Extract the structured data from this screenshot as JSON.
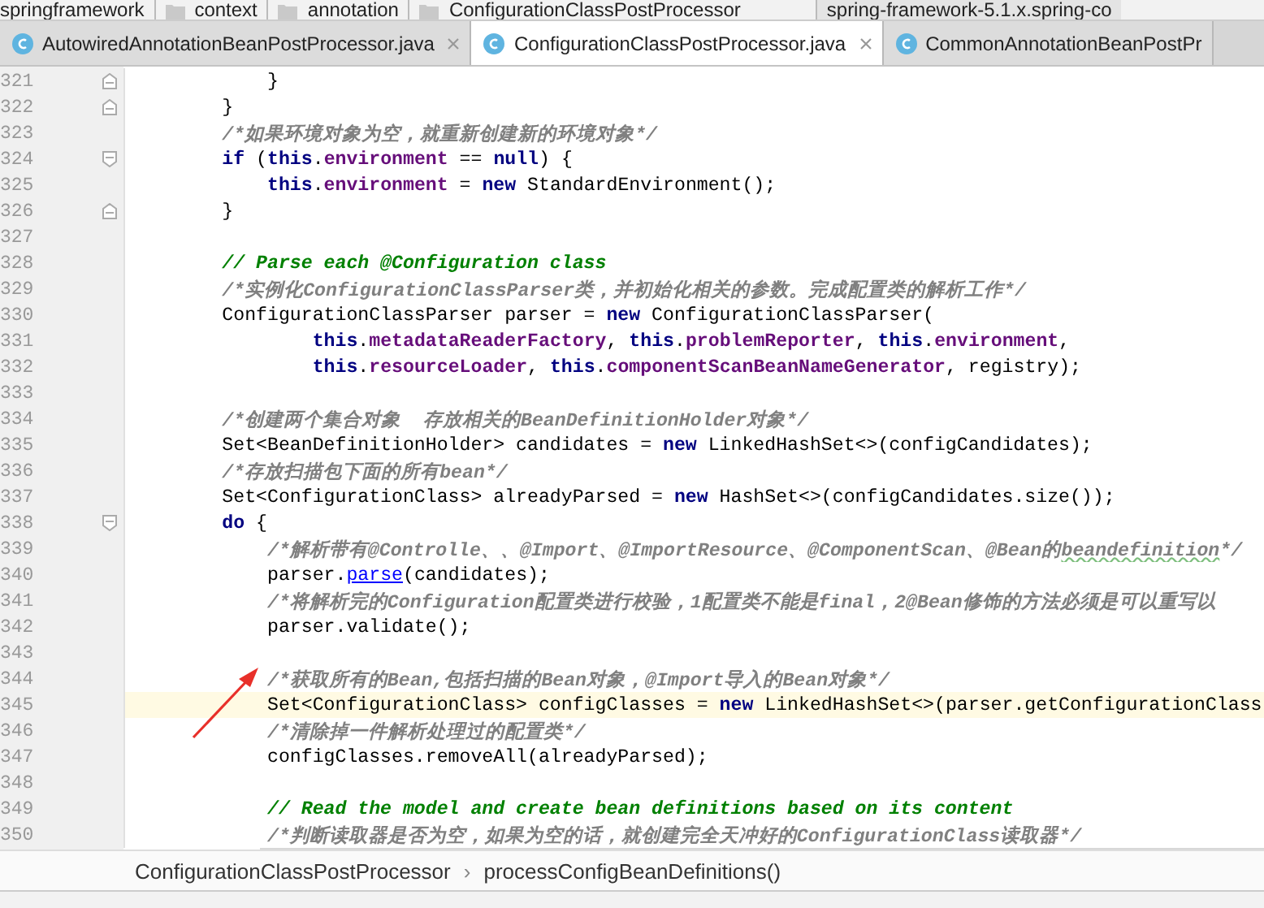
{
  "path_bar": {
    "items": [
      "springframework",
      "context",
      "annotation",
      "ConfigurationClassPostProcessor"
    ],
    "project": "spring-framework-5.1.x.spring-co"
  },
  "tabs": [
    {
      "label": "AutowiredAnnotationBeanPostProcessor.java",
      "selected": false,
      "closable": true
    },
    {
      "label": "ConfigurationClassPostProcessor.java",
      "selected": true,
      "closable": true
    },
    {
      "label": "CommonAnnotationBeanPostPr",
      "selected": false,
      "closable": false
    }
  ],
  "editor": {
    "lines": [
      {
        "number": "321",
        "current": false,
        "kind": "fold_end",
        "segments": [
          {
            "kind": "plain",
            "text": "            }"
          }
        ]
      },
      {
        "number": "322",
        "current": false,
        "kind": "fold_end",
        "segments": [
          {
            "kind": "plain",
            "text": "        }"
          }
        ]
      },
      {
        "number": "323",
        "current": false,
        "kind": "code",
        "segments": [
          {
            "kind": "comment",
            "text": "        /*如果环境对象为空，就重新创建新的环境对象*/"
          }
        ]
      },
      {
        "number": "324",
        "current": false,
        "kind": "fold_start",
        "segments": [
          {
            "kind": "keyword",
            "text": "        if"
          },
          {
            "kind": "plain",
            "text": " ("
          },
          {
            "kind": "keyword",
            "text": "this"
          },
          {
            "kind": "plain",
            "text": "."
          },
          {
            "kind": "field",
            "text": "environment"
          },
          {
            "kind": "plain",
            "text": " == "
          },
          {
            "kind": "keyword",
            "text": "null"
          },
          {
            "kind": "plain",
            "text": ") {"
          }
        ]
      },
      {
        "number": "325",
        "current": false,
        "kind": "code",
        "segments": [
          {
            "kind": "keyword",
            "text": "            this"
          },
          {
            "kind": "plain",
            "text": "."
          },
          {
            "kind": "field",
            "text": "environment"
          },
          {
            "kind": "plain",
            "text": " = "
          },
          {
            "kind": "keyword",
            "text": "new"
          },
          {
            "kind": "plain",
            "text": " StandardEnvironment();"
          }
        ]
      },
      {
        "number": "326",
        "current": false,
        "kind": "fold_end",
        "segments": [
          {
            "kind": "plain",
            "text": "        }"
          }
        ]
      },
      {
        "number": "327",
        "current": false,
        "kind": "code"
      },
      {
        "number": "328",
        "current": false,
        "kind": "code",
        "segments": [
          {
            "kind": "doc",
            "text": "        // Parse each @Configuration class"
          }
        ]
      },
      {
        "number": "329",
        "current": false,
        "kind": "code",
        "segments": [
          {
            "kind": "comment",
            "text": "        /*实例化ConfigurationClassParser类，并初始化相关的参数。完成配置类的解析工作*/"
          }
        ]
      },
      {
        "number": "330",
        "current": false,
        "kind": "code",
        "segments": [
          {
            "kind": "plain",
            "text": "        ConfigurationClassParser parser = "
          },
          {
            "kind": "keyword",
            "text": "new"
          },
          {
            "kind": "plain",
            "text": " ConfigurationClassParser("
          }
        ]
      },
      {
        "number": "331",
        "current": false,
        "kind": "code",
        "segments": [
          {
            "kind": "keyword",
            "text": "                this"
          },
          {
            "kind": "plain",
            "text": "."
          },
          {
            "kind": "field",
            "text": "metadataReaderFactory"
          },
          {
            "kind": "plain",
            "text": ", "
          },
          {
            "kind": "keyword",
            "text": "this"
          },
          {
            "kind": "plain",
            "text": "."
          },
          {
            "kind": "field",
            "text": "problemReporter"
          },
          {
            "kind": "plain",
            "text": ", "
          },
          {
            "kind": "keyword",
            "text": "this"
          },
          {
            "kind": "plain",
            "text": "."
          },
          {
            "kind": "field",
            "text": "environment"
          },
          {
            "kind": "plain",
            "text": ","
          }
        ]
      },
      {
        "number": "332",
        "current": false,
        "kind": "code",
        "segments": [
          {
            "kind": "keyword",
            "text": "                this"
          },
          {
            "kind": "plain",
            "text": "."
          },
          {
            "kind": "field",
            "text": "resourceLoader"
          },
          {
            "kind": "plain",
            "text": ", "
          },
          {
            "kind": "keyword",
            "text": "this"
          },
          {
            "kind": "plain",
            "text": "."
          },
          {
            "kind": "field",
            "text": "componentScanBeanNameGenerator"
          },
          {
            "kind": "plain",
            "text": ", registry);"
          }
        ]
      },
      {
        "number": "333",
        "current": false,
        "kind": "code"
      },
      {
        "number": "334",
        "current": false,
        "kind": "code",
        "segments": [
          {
            "kind": "comment",
            "text": "        /*创建两个集合对象  存放相关的BeanDefinitionHolder对象*/"
          }
        ]
      },
      {
        "number": "335",
        "current": false,
        "kind": "code",
        "segments": [
          {
            "kind": "plain",
            "text": "        Set<BeanDefinitionHolder> candidates = "
          },
          {
            "kind": "keyword",
            "text": "new"
          },
          {
            "kind": "plain",
            "text": " LinkedHashSet<>(configCandidates);"
          }
        ]
      },
      {
        "number": "336",
        "current": false,
        "kind": "code",
        "segments": [
          {
            "kind": "comment",
            "text": "        /*存放扫描包下面的所有bean*/"
          }
        ]
      },
      {
        "number": "337",
        "current": false,
        "kind": "code",
        "segments": [
          {
            "kind": "plain",
            "text": "        Set<ConfigurationClass> alreadyParsed = "
          },
          {
            "kind": "keyword",
            "text": "new"
          },
          {
            "kind": "plain",
            "text": " HashSet<>(configCandidates.size());"
          }
        ]
      },
      {
        "number": "338",
        "current": false,
        "kind": "fold_start",
        "segments": [
          {
            "kind": "keyword",
            "text": "        do"
          },
          {
            "kind": "plain",
            "text": " {"
          }
        ]
      },
      {
        "number": "339",
        "current": false,
        "kind": "code",
        "segments": [
          {
            "kind": "comment",
            "text": "            /*解析带有@Controlle、、@Import、@ImportResource、@ComponentScan、@Bean的"
          },
          {
            "kind": "typo",
            "text": "beandefinition"
          },
          {
            "kind": "comment",
            "text": "*/"
          }
        ]
      },
      {
        "number": "340",
        "current": false,
        "kind": "code",
        "segments": [
          {
            "kind": "plain",
            "text": "            parser."
          },
          {
            "kind": "link",
            "text": "parse"
          },
          {
            "kind": "plain",
            "text": "(candidates);"
          }
        ]
      },
      {
        "number": "341",
        "current": false,
        "kind": "code",
        "segments": [
          {
            "kind": "comment",
            "text": "            /*将解析完的Configuration配置类进行校验，1配置类不能是final，2@Bean修饰的方法必须是可以重写以"
          }
        ]
      },
      {
        "number": "342",
        "current": false,
        "kind": "code",
        "segments": [
          {
            "kind": "plain",
            "text": "            parser.validate();"
          }
        ]
      },
      {
        "number": "343",
        "current": false,
        "kind": "code"
      },
      {
        "number": "344",
        "current": false,
        "kind": "code",
        "segments": [
          {
            "kind": "comment",
            "text": "            /*获取所有的Bean,包括扫描的Bean对象，@Import导入的Bean对象*/"
          }
        ]
      },
      {
        "number": "345",
        "current": true,
        "kind": "code",
        "segments": [
          {
            "kind": "plain",
            "text": "            Set<ConfigurationClass> configClasses = "
          },
          {
            "kind": "keyword",
            "text": "new"
          },
          {
            "kind": "plain",
            "text": " LinkedHashSet<>(parser.getConfigurationClass"
          }
        ]
      },
      {
        "number": "346",
        "current": false,
        "kind": "code",
        "segments": [
          {
            "kind": "comment",
            "text": "            /*清除掉一件解析处理过的配置类*/"
          }
        ]
      },
      {
        "number": "347",
        "current": false,
        "kind": "code",
        "segments": [
          {
            "kind": "plain",
            "text": "            configClasses.removeAll(alreadyParsed);"
          }
        ]
      },
      {
        "number": "348",
        "current": false,
        "kind": "code"
      },
      {
        "number": "349",
        "current": false,
        "kind": "code",
        "segments": [
          {
            "kind": "doc",
            "text": "            // Read the model and create bean definitions based on its content"
          }
        ]
      },
      {
        "number": "350",
        "current": false,
        "kind": "code",
        "segments": [
          {
            "kind": "comment",
            "text": "            /*判断读取器是否为空，如果为空的话，就创建完全天冲好的ConfigurationClass读取器*/"
          }
        ]
      }
    ]
  },
  "breadcrumbs": {
    "items": [
      "ConfigurationClassPostProcessor",
      "processConfigBeanDefinitions()"
    ],
    "separator": "›"
  }
}
